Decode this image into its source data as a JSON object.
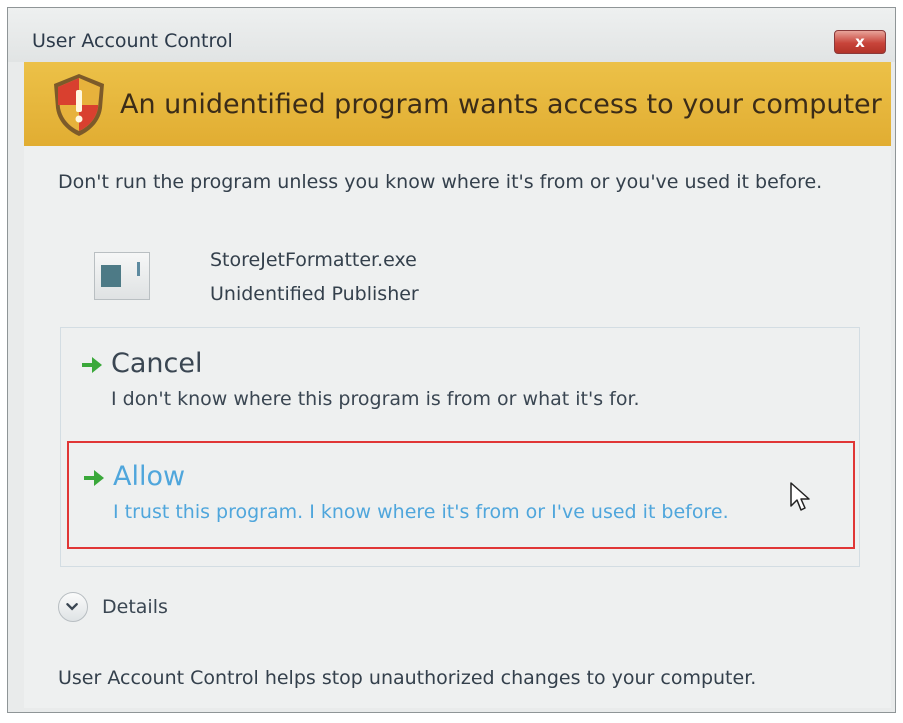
{
  "window": {
    "title": "User Account Control",
    "close_label": "x"
  },
  "banner": {
    "headline": "An unidentified program wants access to your computer",
    "icon": "uac-shield-icon"
  },
  "body": {
    "warning": "Don't run the program unless you know where it's from or you've used it before."
  },
  "program": {
    "icon": "program-icon",
    "name": "StoreJetFormatter.exe",
    "publisher": "Unidentified Publisher"
  },
  "options": {
    "cancel": {
      "title": "Cancel",
      "description": "I don't know where this program is from or what it's for."
    },
    "allow": {
      "title": "Allow",
      "description": "I trust this program. I know where it's from or I've used it before."
    }
  },
  "details": {
    "label": "Details"
  },
  "footer": {
    "text": "User Account Control helps stop unauthorized changes to your computer."
  },
  "colors": {
    "banner": "#e1ad32",
    "link_hover": "#4fa6dc",
    "highlight_border": "#e03636",
    "arrow": "#3aa83a"
  }
}
